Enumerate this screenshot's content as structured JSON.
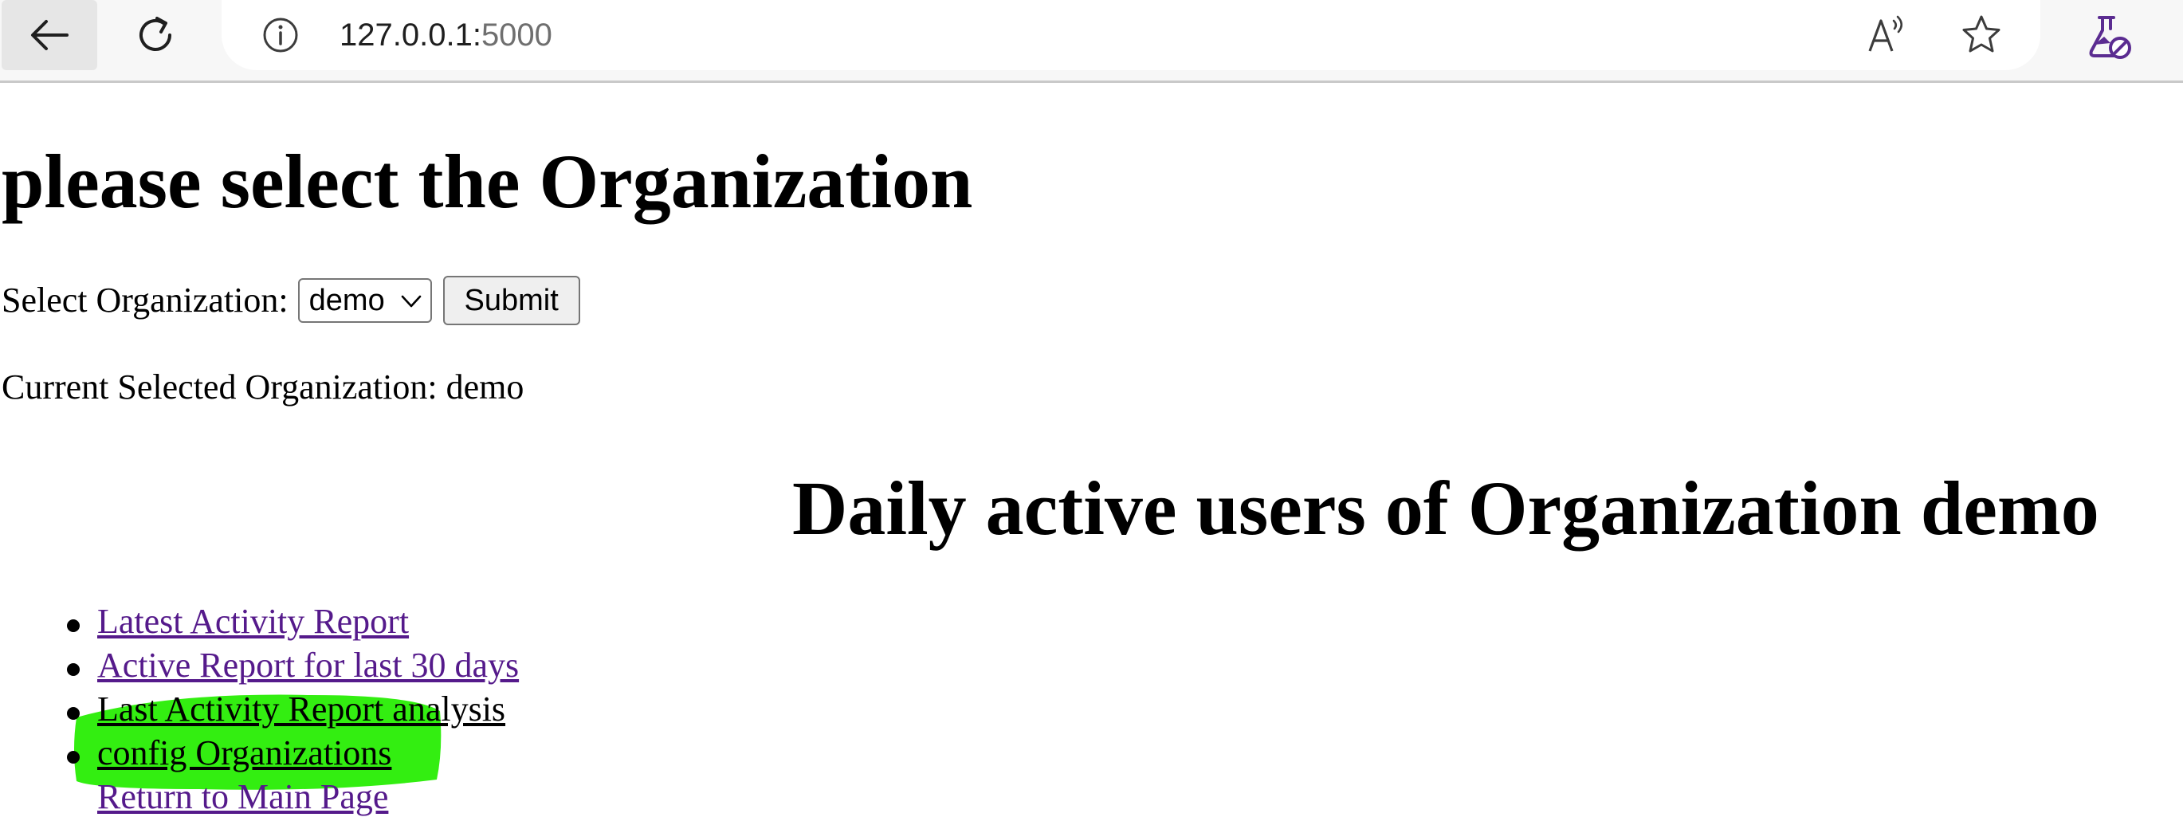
{
  "browser": {
    "url_host": "127.0.0.1:",
    "url_port": "5000"
  },
  "page": {
    "title": "please select the Organization",
    "form": {
      "label": "Select Organization:",
      "selected_org": "demo",
      "submit_label": "Submit"
    },
    "current_org_text": "Current Selected Organization: demo",
    "chart_title": "Daily active users of Organization demo"
  },
  "links": [
    {
      "label": "Latest Activity Report",
      "bullet": true
    },
    {
      "label": "Active Report for last 30 days",
      "bullet": true
    },
    {
      "label": "Last Activity Report analysis",
      "bullet": true
    },
    {
      "label": "config Organizations",
      "bullet": true,
      "highlighted": true
    },
    {
      "label": "Return to Main Page",
      "bullet": false
    }
  ],
  "colors": {
    "link_visited": "#551a8b",
    "highlight": "#33ee11",
    "labs_icon": "#5b2c91"
  }
}
